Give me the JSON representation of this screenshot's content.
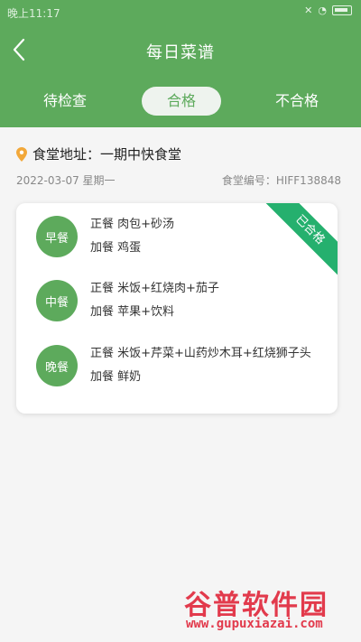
{
  "status": {
    "time": "晚上11:17"
  },
  "header": {
    "title": "每日菜谱"
  },
  "tabs": [
    {
      "label": "待检查"
    },
    {
      "label": "合格"
    },
    {
      "label": "不合格"
    }
  ],
  "canteen": {
    "address": "食堂地址：一期中快食堂",
    "date": "2022-03-07 星期一",
    "code": "食堂编号：HIFF138848"
  },
  "card": {
    "status_ribbon": "已合格",
    "meals": [
      {
        "name": "早餐",
        "main": "正餐 肉包+砂汤",
        "extra": "加餐 鸡蛋"
      },
      {
        "name": "中餐",
        "main": "正餐 米饭+红烧肉+茄子",
        "extra": "加餐 苹果+饮料"
      },
      {
        "name": "晚餐",
        "main": "正餐 米饭+芹菜+山药炒木耳+红烧狮子头",
        "extra": "加餐 鲜奶"
      }
    ]
  },
  "watermark": {
    "top": "谷普软件园",
    "bottom": "www.gupuxiazai.com"
  }
}
